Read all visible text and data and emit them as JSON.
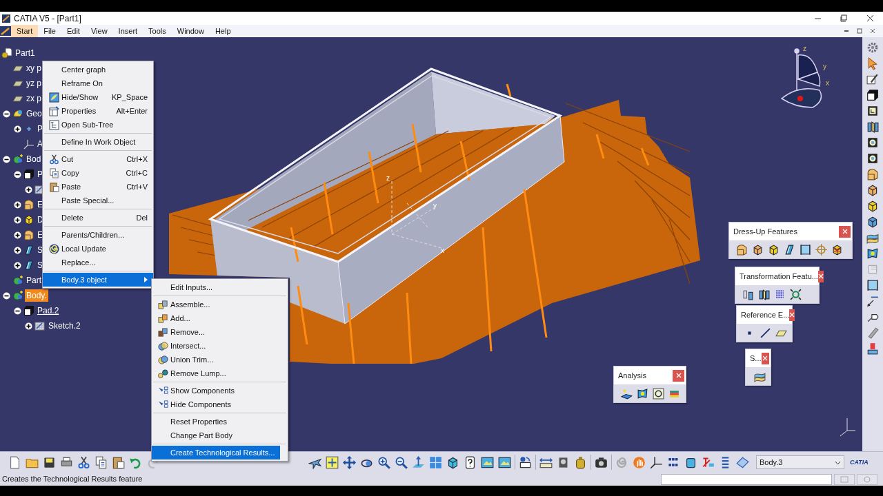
{
  "window": {
    "title": "CATIA V5 - [Part1]"
  },
  "menu_bar": [
    {
      "label": "Start",
      "selected": true
    },
    {
      "label": "File",
      "selected": false
    },
    {
      "label": "Edit",
      "selected": false
    },
    {
      "label": "View",
      "selected": false
    },
    {
      "label": "Insert",
      "selected": false
    },
    {
      "label": "Tools",
      "selected": false
    },
    {
      "label": "Window",
      "selected": false
    },
    {
      "label": "Help",
      "selected": false
    }
  ],
  "tree": {
    "label": "Part1",
    "kind": "part",
    "selected": false,
    "in_work": false,
    "children": [
      {
        "label": "xy p",
        "kind": "plane",
        "selected": false,
        "in_work": false
      },
      {
        "label": "yz p",
        "kind": "plane",
        "selected": false,
        "in_work": false
      },
      {
        "label": "zx p",
        "kind": "plane",
        "selected": false,
        "in_work": false
      },
      {
        "label": "Geo",
        "kind": "geoset",
        "selected": false,
        "in_work": false,
        "expanded": true,
        "children": [
          {
            "label": "P",
            "kind": "point",
            "selected": false,
            "in_work": false,
            "expanded": false
          },
          {
            "label": "A",
            "kind": "axis",
            "selected": false,
            "in_work": false
          }
        ]
      },
      {
        "label": "Bod",
        "kind": "body",
        "selected": false,
        "in_work": false,
        "expanded": true,
        "children": [
          {
            "label": "P",
            "kind": "pad",
            "selected": false,
            "in_work": false,
            "expanded": true,
            "children": [
              {
                "kind": "sketch",
                "expanded": false
              }
            ]
          },
          {
            "label": "E",
            "kind": "fillet",
            "selected": false,
            "in_work": false,
            "expanded": false
          },
          {
            "label": "D",
            "kind": "draft",
            "selected": false,
            "in_work": false,
            "expanded": false
          },
          {
            "label": "E",
            "kind": "fillet",
            "selected": false,
            "in_work": false,
            "expanded": false
          },
          {
            "label": "S",
            "kind": "shell",
            "selected": false,
            "in_work": false,
            "expanded": false
          },
          {
            "label": "S",
            "kind": "shell",
            "selected": false,
            "in_work": false,
            "expanded": false
          }
        ]
      },
      {
        "label": "Part",
        "kind": "body",
        "selected": false,
        "in_work": false
      },
      {
        "label": "Body.",
        "kind": "body",
        "selected": true,
        "in_work": false,
        "expanded": true,
        "children": [
          {
            "label": "Pad.2",
            "kind": "pad",
            "selected": false,
            "in_work": true,
            "expanded": true,
            "children": [
              {
                "label": "Sketch.2",
                "kind": "sketch",
                "selected": false,
                "in_work": false,
                "expanded": false
              }
            ]
          }
        ]
      }
    ]
  },
  "context_menu": {
    "groups": [
      [
        {
          "label": "Center graph",
          "selected": false
        },
        {
          "label": "Reframe On",
          "selected": false
        },
        {
          "label": "Hide/Show",
          "shortcut": "KP_Space",
          "selected": false
        },
        {
          "label": "Properties",
          "shortcut": "Alt+Enter",
          "selected": false
        },
        {
          "label": "Open Sub-Tree",
          "selected": false
        }
      ],
      [
        {
          "label": "Define In Work Object",
          "selected": false
        }
      ],
      [
        {
          "label": "Cut",
          "shortcut": "Ctrl+X",
          "selected": false
        },
        {
          "label": "Copy",
          "shortcut": "Ctrl+C",
          "selected": false
        },
        {
          "label": "Paste",
          "shortcut": "Ctrl+V",
          "selected": false
        },
        {
          "label": "Paste Special...",
          "selected": false
        }
      ],
      [
        {
          "label": "Delete",
          "shortcut": "Del",
          "selected": false
        }
      ],
      [
        {
          "label": "Parents/Children...",
          "selected": false
        },
        {
          "label": "Local Update",
          "selected": false
        },
        {
          "label": "Replace...",
          "selected": false
        }
      ],
      [
        {
          "label": "Body.3 object",
          "submenu": true,
          "selected": true
        }
      ]
    ]
  },
  "submenu": {
    "groups": [
      [
        {
          "label": "Edit Inputs...",
          "selected": false
        }
      ],
      [
        {
          "label": "Assemble...",
          "selected": false
        },
        {
          "label": "Add...",
          "selected": false
        },
        {
          "label": "Remove...",
          "selected": false
        },
        {
          "label": "Intersect...",
          "selected": false
        },
        {
          "label": "Union Trim...",
          "selected": false
        },
        {
          "label": "Remove Lump...",
          "selected": false
        }
      ],
      [
        {
          "label": "Show Components",
          "selected": false
        },
        {
          "label": "Hide Components",
          "selected": false
        }
      ],
      [
        {
          "label": "Reset Properties",
          "selected": false
        },
        {
          "label": "Change Part Body",
          "selected": false
        }
      ],
      [
        {
          "label": "Create Technological Results...",
          "selected": true
        }
      ]
    ]
  },
  "viewport": {
    "axis_labels": [
      "z",
      "y",
      "x"
    ]
  },
  "compass": {
    "labels": [
      "z",
      "y",
      "x"
    ]
  },
  "floating_toolbars": [
    {
      "title": "Dress-Up Features"
    },
    {
      "title": "Transformation Featu..."
    },
    {
      "title": "Reference E..."
    },
    {
      "title": "S..."
    },
    {
      "title": "Analysis"
    }
  ],
  "bottom_toolbar": {
    "current_body": "Body.3",
    "logo": "CATIA"
  },
  "status_bar": {
    "message": "Creates the Technological Results feature"
  }
}
